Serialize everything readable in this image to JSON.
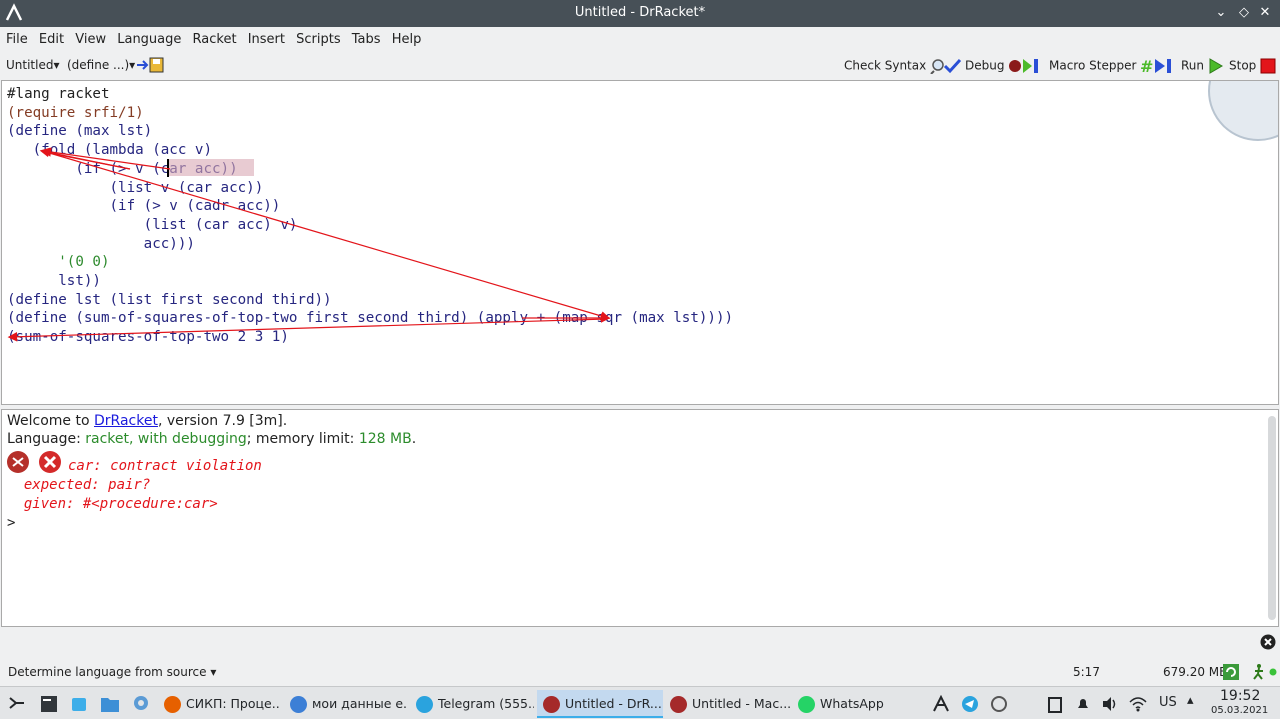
{
  "window": {
    "title": "Untitled - DrRacket*"
  },
  "menu": [
    "File",
    "Edit",
    "View",
    "Language",
    "Racket",
    "Insert",
    "Scripts",
    "Tabs",
    "Help"
  ],
  "toolbar": {
    "tab_selector": "Untitled",
    "define_selector": "(define ...)",
    "check_syntax": "Check Syntax",
    "debug": "Debug",
    "macro_stepper": "Macro Stepper",
    "run": "Run",
    "stop": "Stop"
  },
  "editor": {
    "lines": [
      "#lang racket",
      "(require srfi/1)",
      "(define (max lst)",
      "   (fold (lambda (acc v)",
      "        (if (> v (car acc))",
      "            (list v (car acc))",
      "            (if (> v (cadr acc))",
      "                (list (car acc) v)",
      "                acc)))",
      "      '(0 0)",
      "      lst))",
      "(define lst (list first second third))",
      "(define (sum-of-squares-of-top-two first second third) (apply + (map sqr (max lst))))",
      "(sum-of-squares-of-top-two 2 3 1)"
    ]
  },
  "repl": {
    "welcome_prefix": "Welcome to ",
    "welcome_link": "DrRacket",
    "welcome_suffix": ", version 7.9 [3m].",
    "language_prefix": "Language: ",
    "language_value": "racket, with debugging",
    "memory_prefix": "; memory limit: ",
    "memory_value": "128 MB",
    "memory_suffix": ".",
    "error_line1": "car: contract violation",
    "error_line2": "  expected: pair?",
    "error_line3": "  given: #<procedure:car>",
    "prompt": ">"
  },
  "status": {
    "language": "Determine language from source",
    "position": "5:17",
    "memory": "679.20 MB"
  },
  "taskbar": {
    "tasks": [
      {
        "label": "СИКП: Проце...",
        "color": "#e66000"
      },
      {
        "label": "мои данные е...",
        "color": "#3c7fd6"
      },
      {
        "label": "Telegram (555...",
        "color": "#2aa3de"
      },
      {
        "label": "Untitled - DrR...",
        "color": "#a52a2a"
      },
      {
        "label": "Untitled - Mac...",
        "color": "#a52a2a"
      },
      {
        "label": "WhatsApp",
        "color": "#25d366"
      }
    ],
    "keyboard": "US",
    "time": "19:52",
    "date": "05.03.2021"
  },
  "colors": {
    "titlebar": "#475057",
    "error": "#e3151b",
    "paren": "#843c24",
    "identifier": "#262680"
  }
}
